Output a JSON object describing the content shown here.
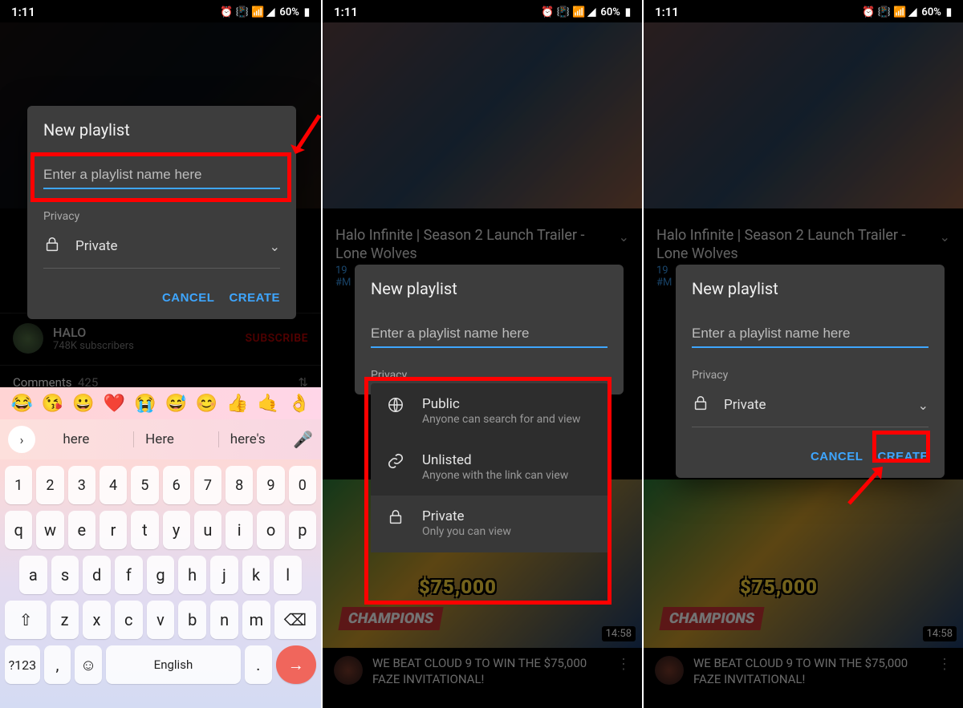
{
  "status": {
    "time": "1:11",
    "battery": "60%"
  },
  "video": {
    "title": "Halo Infinite | Season 2 Launch Trailer - Lone Wolves",
    "views_line": "19",
    "tags": "#M"
  },
  "channel": {
    "name": "HALO",
    "subs": "748K subscribers"
  },
  "subscribe_label": "SUBSCRIBE",
  "comments": {
    "label": "Comments",
    "count": "425"
  },
  "dialog": {
    "title": "New playlist",
    "placeholder": "Enter a playlist name here",
    "privacy_label": "Privacy",
    "privacy_value": "Private",
    "cancel": "CANCEL",
    "create": "CREATE"
  },
  "privacy_options": [
    {
      "title": "Public",
      "sub": "Anyone can search for and view"
    },
    {
      "title": "Unlisted",
      "sub": "Anyone with the link can view"
    },
    {
      "title": "Private",
      "sub": "Only you can view"
    }
  ],
  "keyboard": {
    "emojis": [
      "😂",
      "😘",
      "😀",
      "❤️",
      "😭",
      "😅",
      "😊",
      "👍",
      "🤙",
      "👌"
    ],
    "suggestions": [
      "here",
      "Here",
      "here's"
    ],
    "space_label": "English",
    "sym_label": "?123"
  },
  "rec": {
    "duration": "14:58",
    "prize": "$75,000",
    "champ": "CHAMPIONS",
    "title": "WE BEAT CLOUD 9 TO WIN THE $75,000 FAZE INVITATIONAL!"
  }
}
